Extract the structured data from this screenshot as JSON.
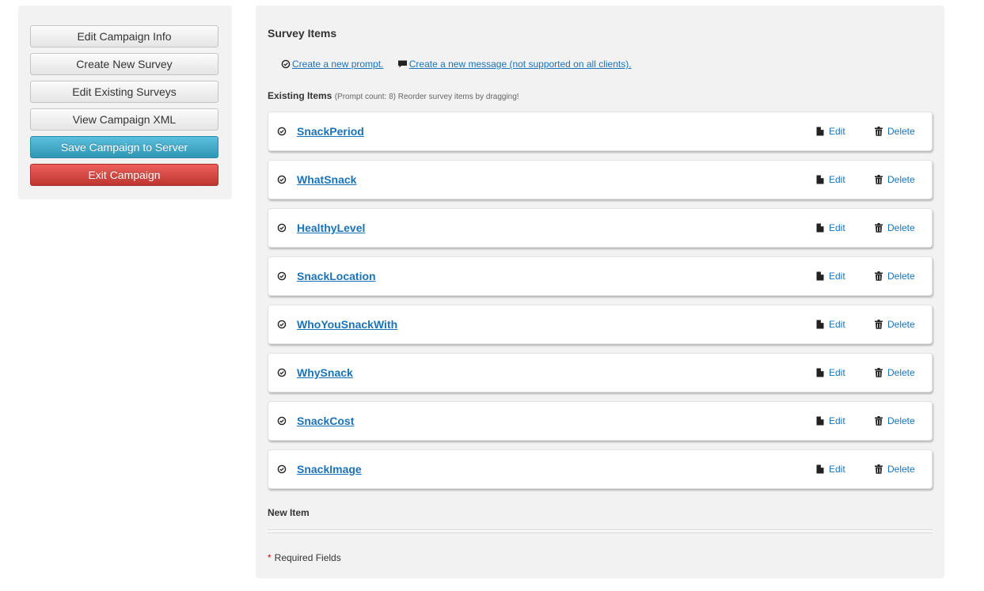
{
  "sidebar": {
    "buttons": [
      {
        "label": "Edit Campaign Info"
      },
      {
        "label": "Create New Survey"
      },
      {
        "label": "Edit Existing Surveys"
      },
      {
        "label": "View Campaign XML"
      },
      {
        "label": "Save Campaign to Server",
        "style": "primary",
        "color": "#3fa9cc"
      },
      {
        "label": "Exit Campaign",
        "style": "danger",
        "color": "#d9443f"
      }
    ]
  },
  "main": {
    "survey_items_title": "Survey Items",
    "create_prompt_link": "Create a new prompt.",
    "create_message_link": "Create a new message (not supported on all clients).",
    "existing_title": "Existing Items",
    "existing_subtitle": "(Prompt count: 8) Reorder survey items by dragging!",
    "edit_label": "Edit",
    "delete_label": "Delete",
    "items": [
      {
        "name": "SnackPeriod"
      },
      {
        "name": "WhatSnack"
      },
      {
        "name": "HealthyLevel"
      },
      {
        "name": "SnackLocation"
      },
      {
        "name": "WhoYouSnackWith"
      },
      {
        "name": "WhySnack"
      },
      {
        "name": "SnackCost"
      },
      {
        "name": "SnackImage"
      }
    ],
    "new_item_title": "New Item",
    "required_star": "*",
    "required_text": "Required Fields"
  },
  "icons": {
    "prompt": "check-circle-icon",
    "message": "comment-icon",
    "edit": "file-icon",
    "delete": "trash-icon"
  },
  "colors": {
    "link": "#1a73b8",
    "panel": "#f2f2f2",
    "required": "#dd0000"
  }
}
